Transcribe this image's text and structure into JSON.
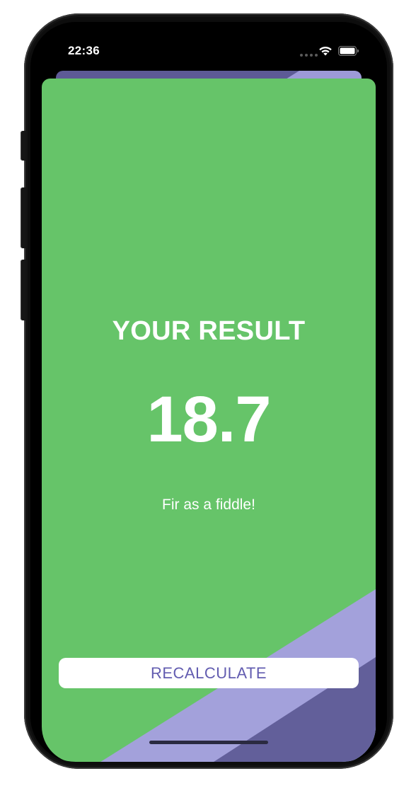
{
  "status_bar": {
    "time": "22:36",
    "wifi_icon": "wifi-icon",
    "battery_icon": "battery-icon"
  },
  "result": {
    "title": "YOUR RESULT",
    "value": "18.7",
    "advice": "Fir as a fiddle!"
  },
  "actions": {
    "recalculate_label": "RECALCULATE"
  },
  "colors": {
    "result_background": "#66c469",
    "stripe_light": "#a3a1db",
    "stripe_dark": "#625f9a",
    "button_text": "#625cb0",
    "button_background": "#ffffff"
  }
}
